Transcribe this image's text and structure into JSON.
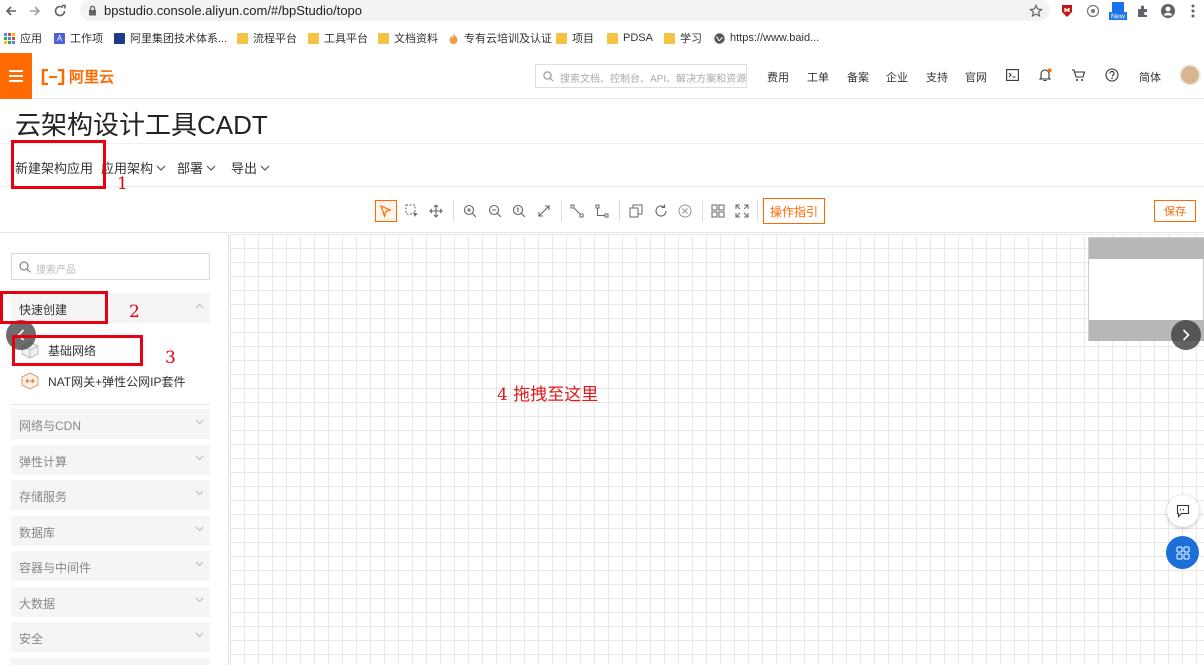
{
  "browser": {
    "url": "bpstudio.console.aliyun.com/#/bpStudio/topo",
    "bookmarks": [
      "应用",
      "工作项",
      "阿里集团技术体系...",
      "流程平台",
      "工具平台",
      "文档资料",
      "专有云培训及认证",
      "项目",
      "PDSA",
      "学习",
      "https://www.baid..."
    ],
    "new_badge": "New"
  },
  "header": {
    "logo": "阿里云",
    "search_placeholder": "搜索文档、控制台、API、解决方案和资源",
    "nav": [
      "费用",
      "工单",
      "备案",
      "企业",
      "支持",
      "官网"
    ],
    "lang": "简体"
  },
  "page": {
    "title": "云架构设计工具CADT",
    "menu": [
      "新建架构应用",
      "应用架构",
      "部署",
      "导出"
    ]
  },
  "tools": {
    "guide_label": "操作指引",
    "save_label": "保存"
  },
  "panel": {
    "search_placeholder": "搜索产品",
    "quick_create": "快速创建",
    "quick_items": [
      "基础网络",
      "NAT网关+弹性公网IP套件"
    ],
    "groups": [
      "网络与CDN",
      "弹性计算",
      "存储服务",
      "数据库",
      "容器与中间件",
      "大数据",
      "安全"
    ]
  },
  "canvas": {
    "note": "4 拖拽至这里"
  },
  "annotations": [
    "1",
    "2",
    "3"
  ],
  "colors": {
    "brand": "#ff6a00",
    "annotation": "#e60012"
  }
}
